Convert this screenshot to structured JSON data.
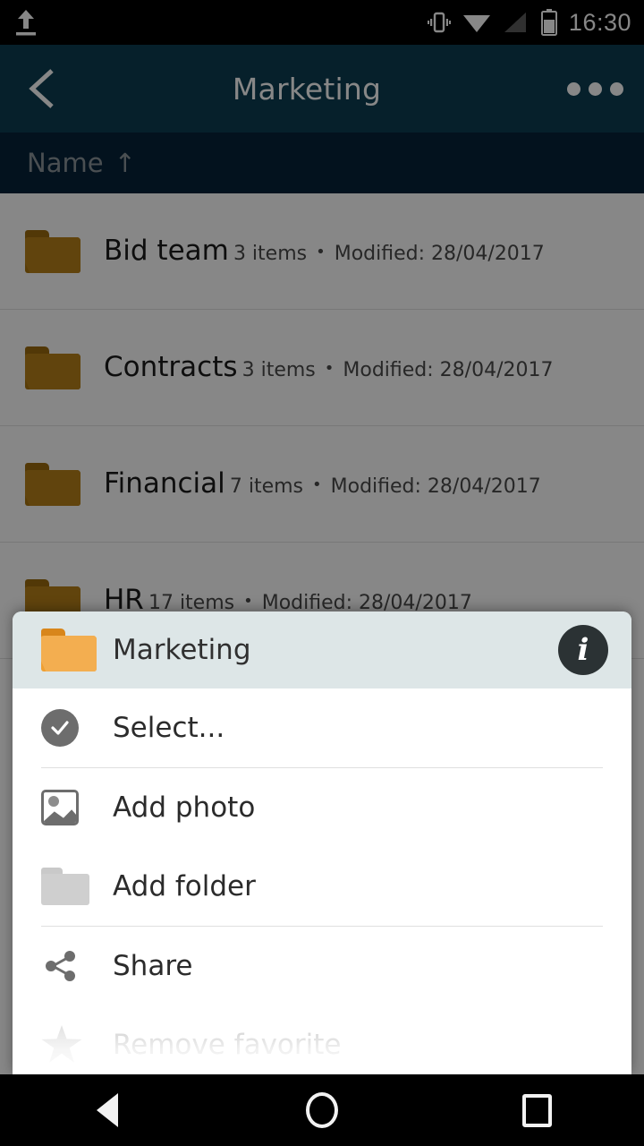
{
  "status_bar": {
    "time": "16:30",
    "icons": [
      "upload-icon",
      "vibrate-icon",
      "wifi-icon",
      "signal-icon",
      "battery-icon"
    ]
  },
  "app_bar": {
    "back_icon": "back-chevron-icon",
    "title": "Marketing",
    "overflow_icon": "overflow-menu-icon",
    "background_color": "#0c3e51"
  },
  "sort_bar": {
    "label": "Name",
    "arrow": "↑",
    "background_color": "#07223a"
  },
  "file_list": {
    "rows": [
      {
        "name": "Bid team",
        "items": "3 items",
        "separator": "•",
        "modified": "Modified: 28/04/2017",
        "icon": "folder-icon"
      },
      {
        "name": "Contracts",
        "items": "3 items",
        "separator": "•",
        "modified": "Modified: 28/04/2017",
        "icon": "folder-icon"
      },
      {
        "name": "Financial",
        "items": "7 items",
        "separator": "•",
        "modified": "Modified: 28/04/2017",
        "icon": "folder-icon"
      },
      {
        "name": "HR",
        "items": "17 items",
        "separator": "•",
        "modified": "Modified: 28/04/2017",
        "icon": "folder-icon"
      }
    ]
  },
  "bottom_sheet": {
    "header": {
      "title": "Marketing",
      "icon": "folder-icon",
      "info_label": "i",
      "background_color": "#dde6e7"
    },
    "items": [
      {
        "label": "Select...",
        "icon": "check-circle-icon",
        "faded": false
      },
      {
        "label": "Add photo",
        "icon": "image-icon",
        "faded": false
      },
      {
        "label": "Add folder",
        "icon": "folder-outline-icon",
        "faded": false
      },
      {
        "label": "Share",
        "icon": "share-icon",
        "faded": false
      },
      {
        "label": "Remove favorite",
        "icon": "star-icon",
        "faded": true
      }
    ]
  },
  "nav_bar": {
    "back": "back-triangle-icon",
    "home": "home-circle-icon",
    "recents": "recents-square-icon"
  }
}
